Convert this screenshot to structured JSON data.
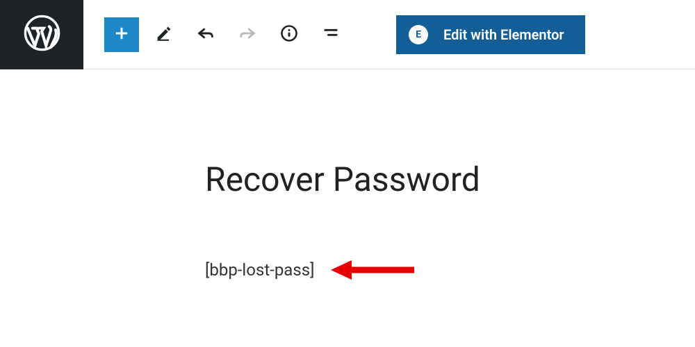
{
  "toolbar": {
    "elementor_button_label": "Edit with Elementor",
    "elementor_badge": "E"
  },
  "editor": {
    "page_title": "Recover Password",
    "shortcode": "[bbp-lost-pass]"
  }
}
